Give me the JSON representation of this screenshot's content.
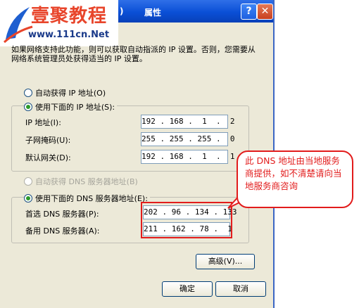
{
  "window": {
    "title": "属性",
    "title_paren": ")"
  },
  "watermark": {
    "brand": "壹聚教程",
    "url": "www.111cn.Net"
  },
  "description": "如果网络支持此功能，则可以获取自动指派的 IP 设置。否则，您需要从网络系统管理员处获得适当的 IP 设置。",
  "ip": {
    "auto_label": "自动获得 IP 地址(O)",
    "manual_label": "使用下面的 IP 地址(S):",
    "selected": "manual",
    "fields": [
      {
        "label": "IP 地址(I):",
        "value": "192 . 168 .  1  .  2"
      },
      {
        "label": "子网掩码(U):",
        "value": "255 . 255 . 255 .  0"
      },
      {
        "label": "默认网关(D):",
        "value": "192 . 168 .  1  .  1"
      }
    ]
  },
  "dns": {
    "auto_label": "自动获得 DNS 服务器地址(B)",
    "manual_label": "使用下面的 DNS 服务器地址(E):",
    "selected": "manual",
    "fields": [
      {
        "label": "首选 DNS 服务器(P):",
        "value": "202 . 96 . 134 . 133"
      },
      {
        "label": "备用 DNS 服务器(A):",
        "value": "211 . 162 . 78 .  1"
      }
    ]
  },
  "buttons": {
    "advanced": "高级(V)...",
    "ok": "确定",
    "cancel": "取消"
  },
  "callout": {
    "text": "此 DNS 地址由当地服务商提供，如不清楚请向当地服务商咨询"
  },
  "colors": {
    "titlebar": "#0a4fd6",
    "highlight": "#e21c1c",
    "dialog_bg": "#ece9d8"
  }
}
